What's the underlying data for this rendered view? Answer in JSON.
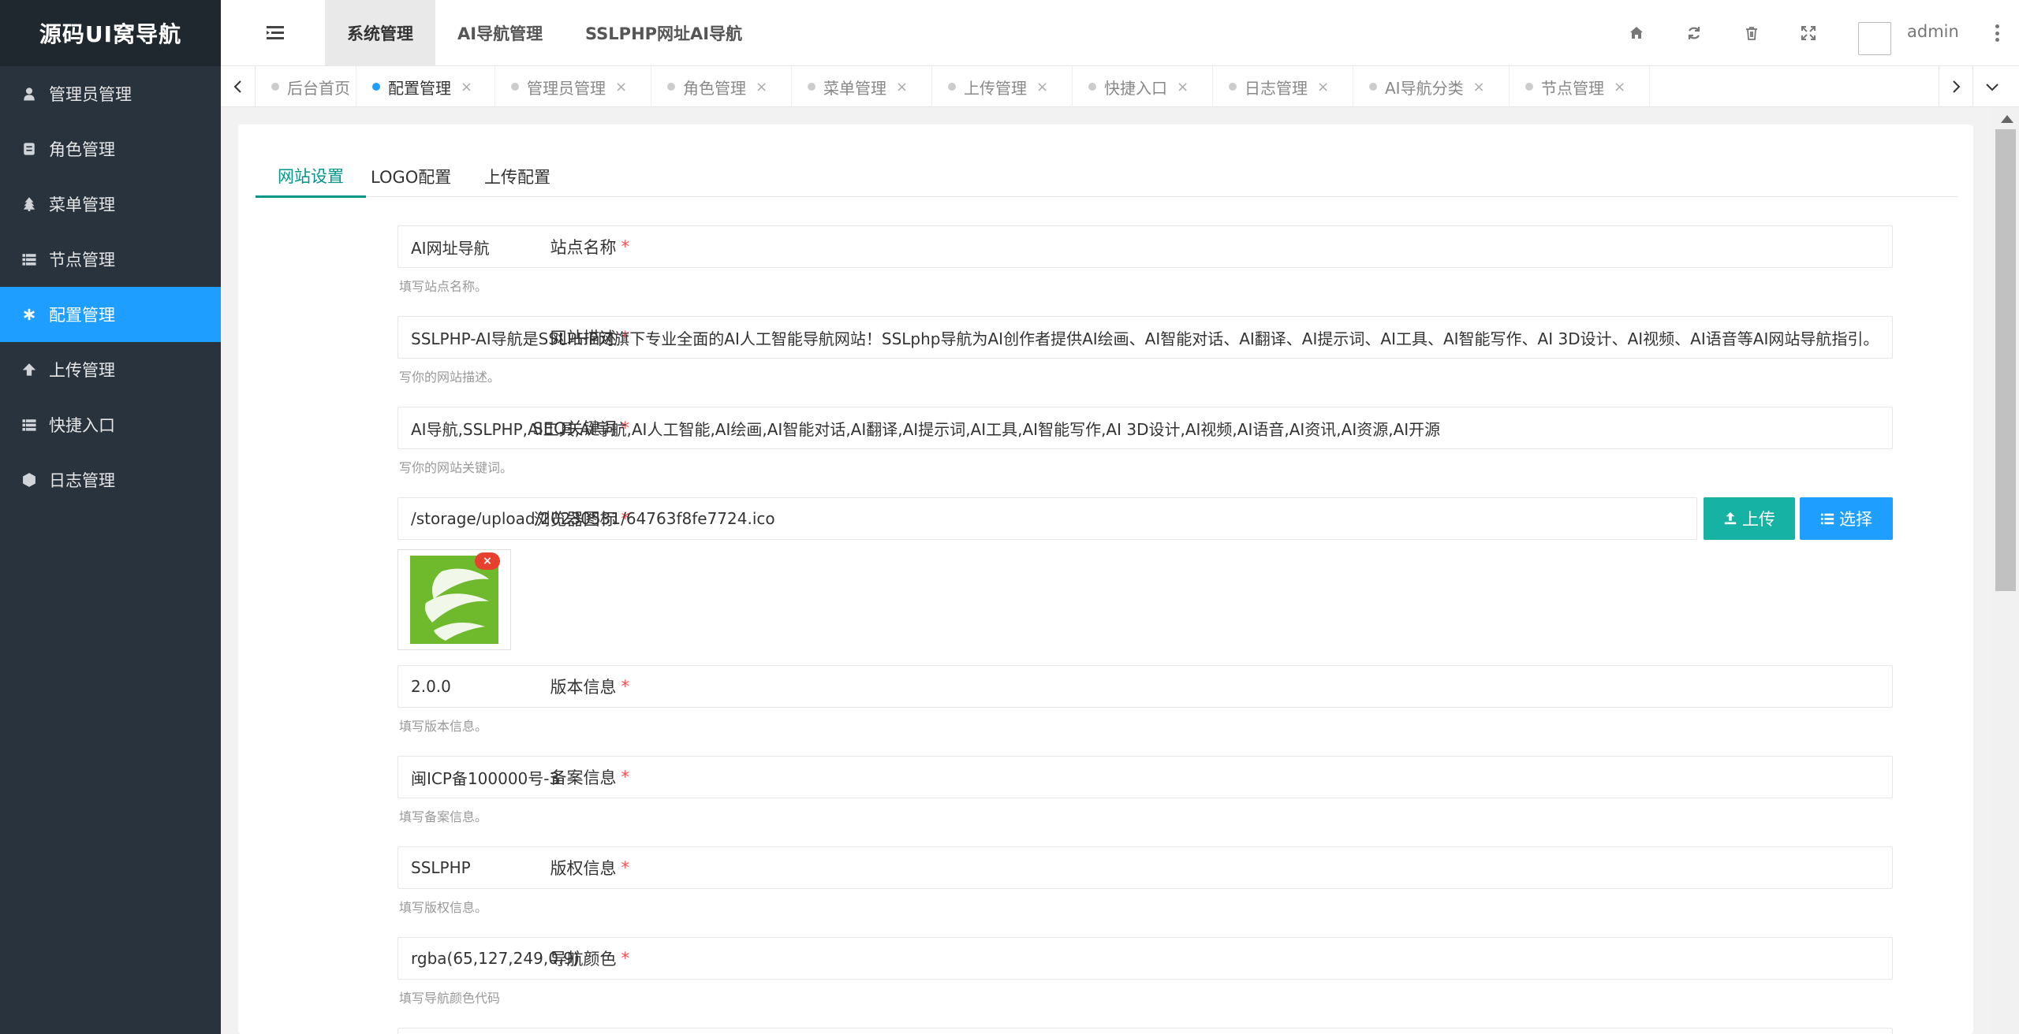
{
  "app": {
    "logo": "源码UI窝导航"
  },
  "sidebar": {
    "items": [
      {
        "label": "管理员管理",
        "icon": "user-icon"
      },
      {
        "label": "角色管理",
        "icon": "role-icon"
      },
      {
        "label": "菜单管理",
        "icon": "tree-icon"
      },
      {
        "label": "节点管理",
        "icon": "list-icon"
      },
      {
        "label": "配置管理",
        "icon": "gear-icon",
        "active": true
      },
      {
        "label": "上传管理",
        "icon": "arrow-up-icon"
      },
      {
        "label": "快捷入口",
        "icon": "list-icon"
      },
      {
        "label": "日志管理",
        "icon": "log-icon"
      }
    ]
  },
  "header": {
    "tabs": [
      "系统管理",
      "AI导航管理",
      "SSLPHP网址AI导航"
    ],
    "active_tab": "系统管理",
    "username": "admin"
  },
  "page_tabs": [
    {
      "label": "后台首页"
    },
    {
      "label": "配置管理",
      "active": true
    },
    {
      "label": "管理员管理"
    },
    {
      "label": "角色管理"
    },
    {
      "label": "菜单管理"
    },
    {
      "label": "上传管理"
    },
    {
      "label": "快捷入口"
    },
    {
      "label": "日志管理"
    },
    {
      "label": "AI导航分类"
    },
    {
      "label": "节点管理"
    }
  ],
  "form_tabs": [
    "网站设置",
    "LOGO配置",
    "上传配置"
  ],
  "form": {
    "site_name": {
      "label": "站点名称",
      "value": "AI网址导航",
      "hint": "填写站点名称。"
    },
    "site_desc": {
      "label": "网站描述",
      "value": "SSLPHP-AI导航是SSLPHP网旗下专业全面的AI人工智能导航网站！SSLphp导航为AI创作者提供AI绘画、AI智能对话、AI翻译、AI提示词、AI工具、AI智能写作、AI 3D设计、AI视频、AI语音等AI网站导航指引。",
      "hint": "写你的网站描述。"
    },
    "seo_keywords": {
      "label": "SEO关键词",
      "value": "AI导航,SSLPHP,AI工具,AI导航,AI人工智能,AI绘画,AI智能对话,AI翻译,AI提示词,AI工具,AI智能写作,AI 3D设计,AI视频,AI语音,AI资讯,AI资源,AI开源",
      "hint": "写你的网站关键词。"
    },
    "favicon": {
      "label": "浏览器图标",
      "value": "/storage/upload/20230531/64763f8fe7724.ico",
      "upload_label": "上传",
      "select_label": "选择"
    },
    "version": {
      "label": "版本信息",
      "value": "2.0.0",
      "hint": "填写版本信息。"
    },
    "icp": {
      "label": "备案信息",
      "value": "闽ICP备100000号-3",
      "hint": "填写备案信息。"
    },
    "copyright": {
      "label": "版权信息",
      "value": "SSLPHP",
      "hint": "填写版权信息。"
    },
    "nav_color": {
      "label": "导航颜色",
      "value": "rgba(65,127,249,0.9)",
      "hint": "填写导航颜色代码"
    }
  },
  "colors": {
    "sidebar_bg": "#28333e",
    "active_blue": "#1e9fff",
    "teal": "#009688",
    "upload_btn": "#16b2a4",
    "required": "#ff4d4f"
  }
}
